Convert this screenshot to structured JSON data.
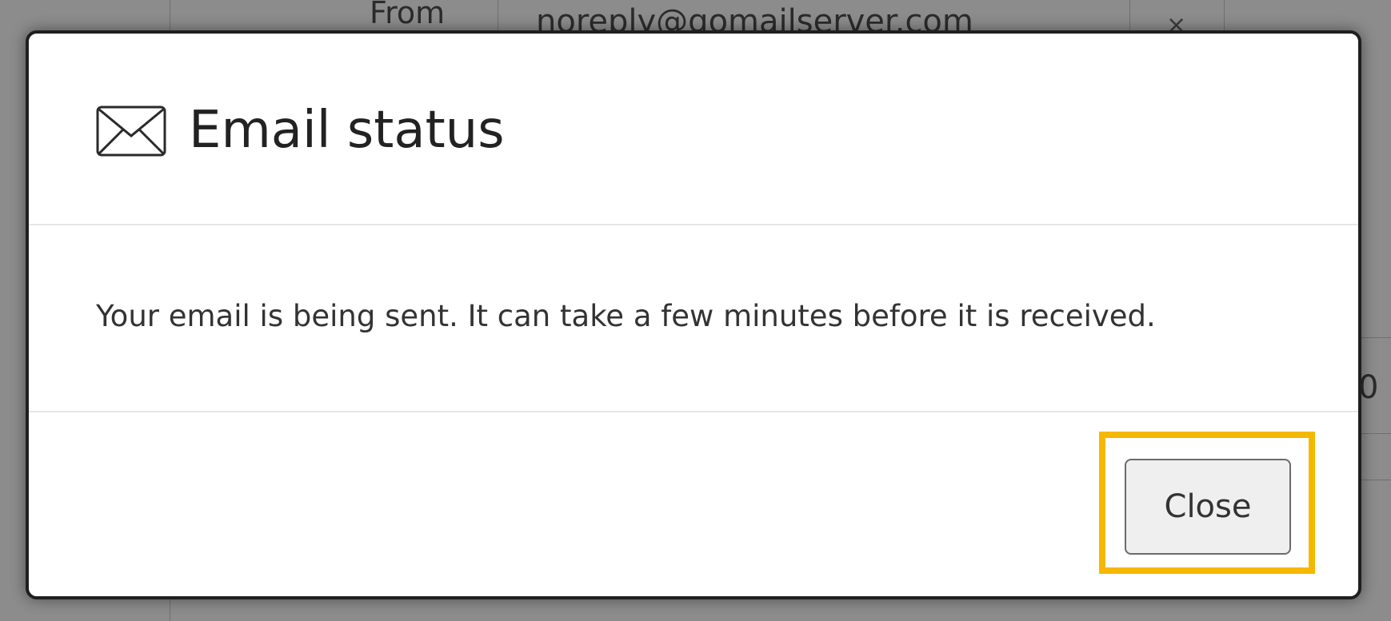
{
  "background_form": {
    "from_label": "From",
    "from_value": "noreply@gomailserver.com",
    "clear_symbol": "×",
    "right_fragment": "0"
  },
  "dialog": {
    "icon": "mail-icon",
    "title": "Email status",
    "message": "Your email is being sent. It can take a few minutes before it is received.",
    "close_label": "Close",
    "highlight_color": "#f5b800"
  }
}
